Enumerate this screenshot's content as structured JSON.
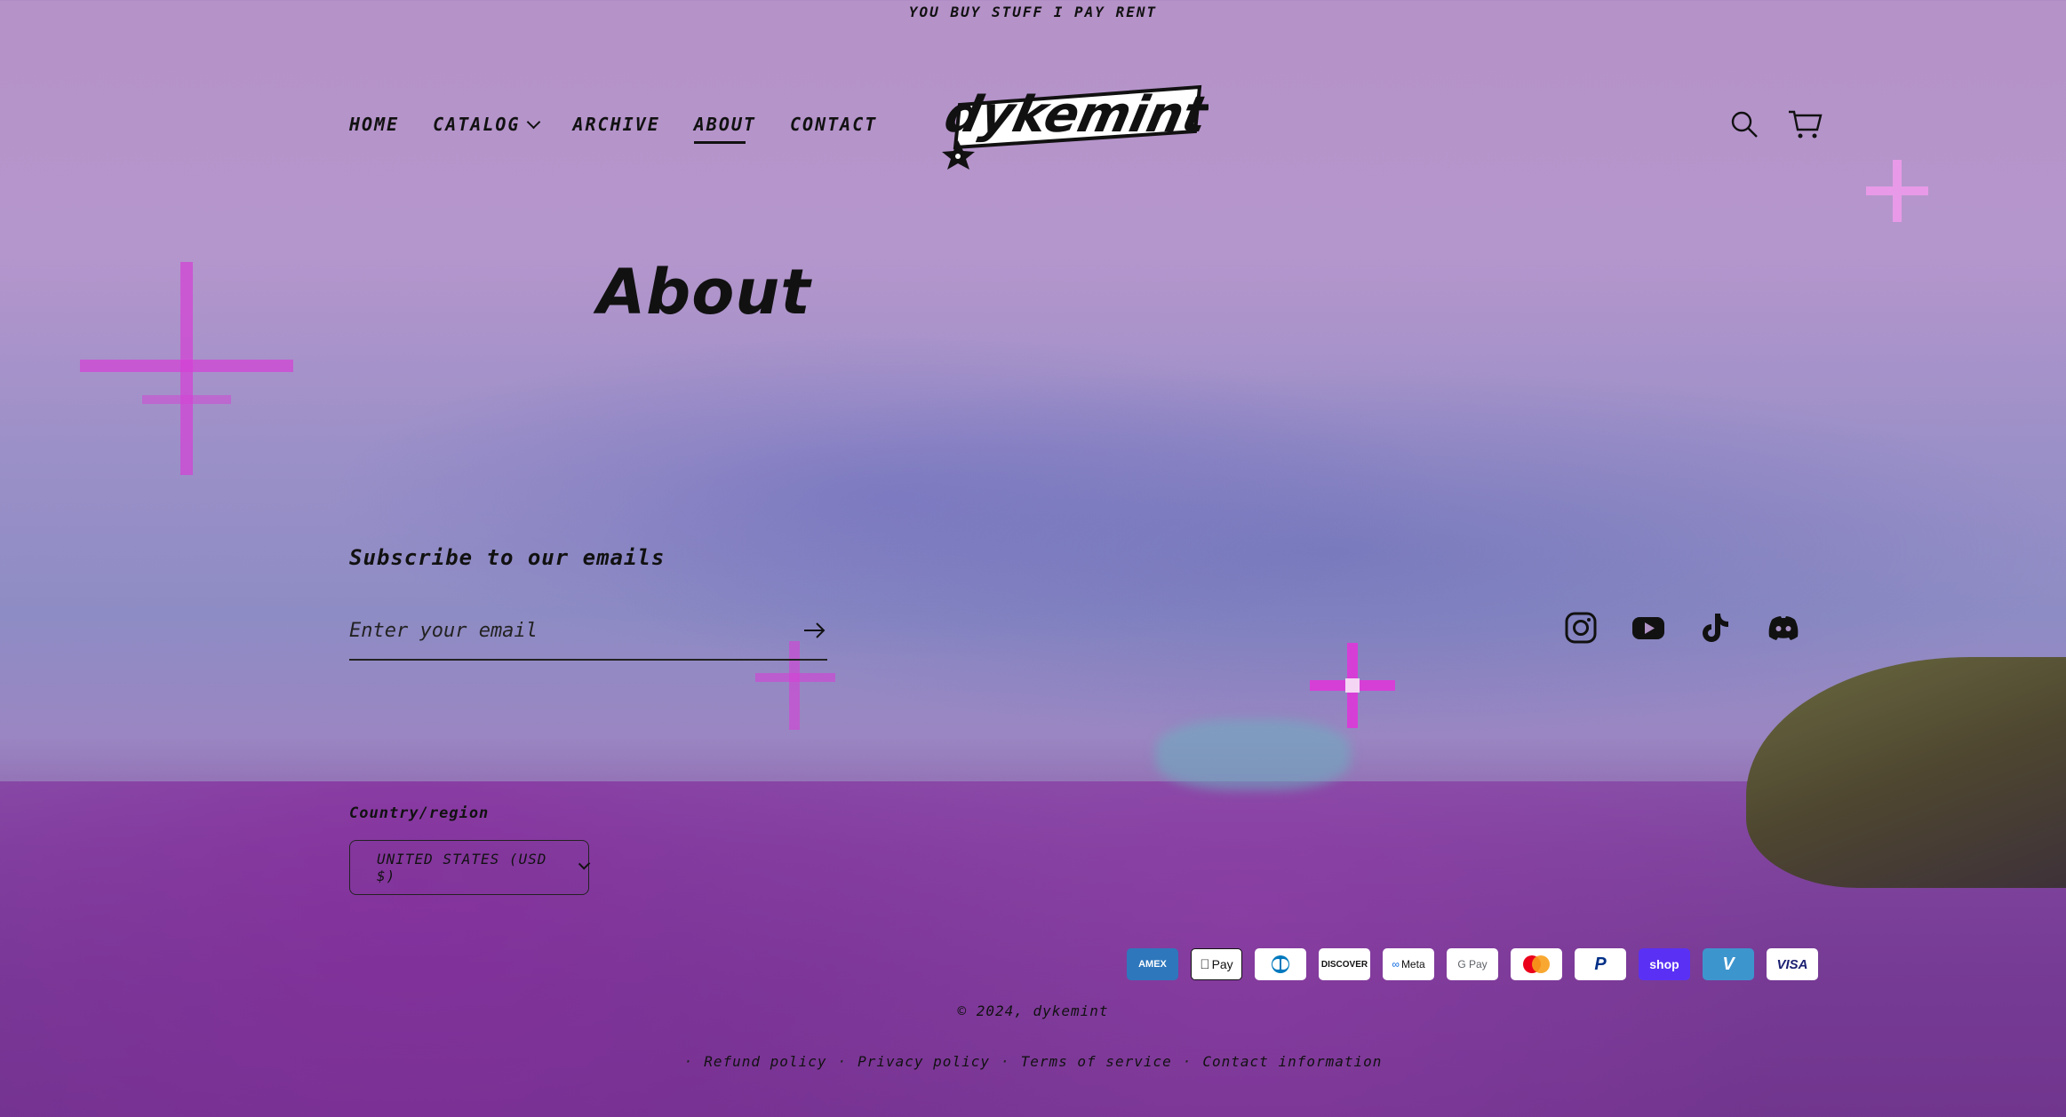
{
  "announcement": "YOU BUY STUFF I PAY RENT",
  "nav": {
    "home": "HOME",
    "catalog": "CATALOG",
    "archive": "ARCHIVE",
    "about": "ABOUT",
    "contact": "CONTACT"
  },
  "logo_text": "dykemint",
  "header_icons": [
    "search-icon",
    "cart-icon"
  ],
  "page": {
    "title": "About"
  },
  "newsletter": {
    "title": "Subscribe to our emails",
    "placeholder": "Enter your email"
  },
  "social": [
    "instagram-icon",
    "youtube-icon",
    "tiktok-icon",
    "discord-icon"
  ],
  "country": {
    "label": "Country/region",
    "selected": "UNITED STATES (USD $)"
  },
  "payments": {
    "amex": "AMEX",
    "apple_pay": "Pay",
    "diners": "D",
    "discover": "DISCOVER",
    "meta": "Meta",
    "google_pay": "G Pay",
    "mastercard": "",
    "paypal": "P",
    "shop_pay": "shop",
    "venmo": "V",
    "visa": "VISA"
  },
  "copyright": "© 2024, dykemint",
  "policies": {
    "refund": "Refund policy",
    "privacy": "Privacy policy",
    "terms": "Terms of service",
    "contact": "Contact information"
  },
  "colors": {
    "sky_top": "#b592c8",
    "sky_mid": "#8e8cc4",
    "ground": "#7b4a98",
    "sparkle": "#d63fd6"
  }
}
